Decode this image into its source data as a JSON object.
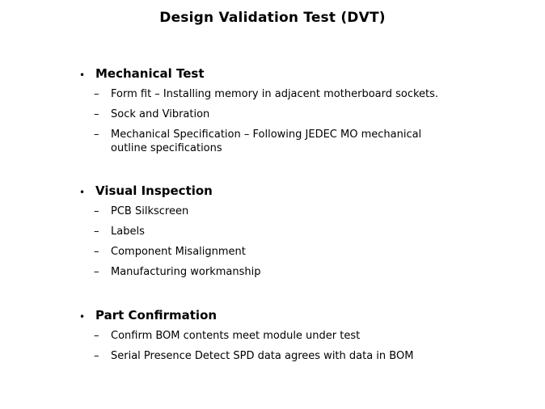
{
  "slide": {
    "title": "Design Validation Test (DVT)",
    "bullet_glyph": "•",
    "dash_glyph": "–",
    "sections": [
      {
        "title": "Mechanical  Test",
        "items": [
          "Form fit – Installing  memory  in adjacent motherboard sockets.",
          "Sock and Vibration",
          "Mechanical  Specification  – Following  JEDEC MO mechanical\noutline specifications"
        ]
      },
      {
        "title": "Visual  Inspection",
        "items": [
          "PCB Silkscreen",
          "Labels",
          "Component Misalignment",
          "Manufacturing  workmanship"
        ]
      },
      {
        "title": "Part Confirmation",
        "items": [
          "Confirm BOM contents meet module under test",
          "Serial  Presence  Detect SPD data agrees with data in BOM"
        ]
      }
    ]
  }
}
